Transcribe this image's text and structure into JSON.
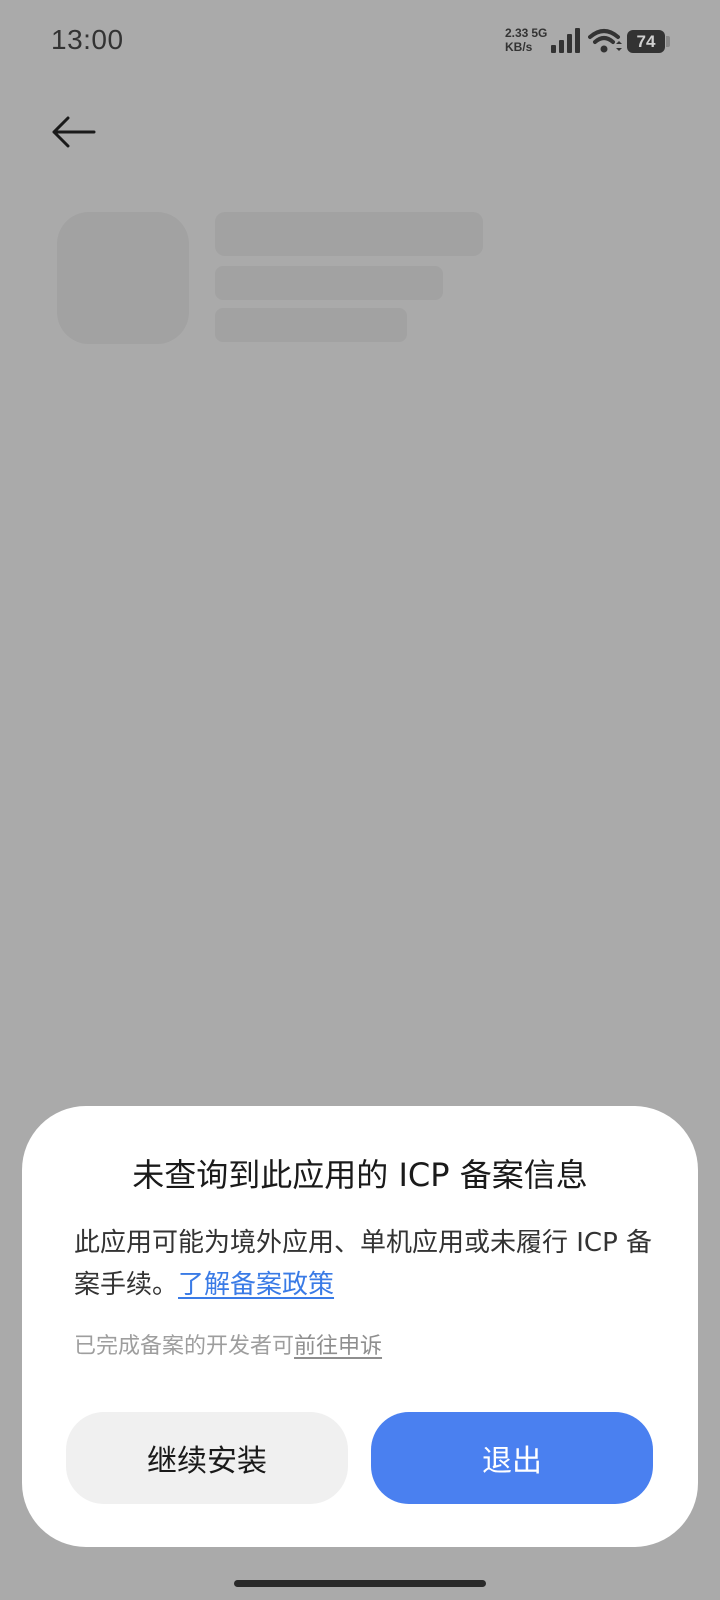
{
  "status_bar": {
    "time": "13:00",
    "net_speed_value": "2.33",
    "net_type": "5G",
    "net_speed_unit": "KB/s",
    "battery_level": "74",
    "icons": [
      "signal-icon",
      "wifi-icon",
      "battery-icon"
    ]
  },
  "header": {
    "back_icon": "arrow-left-icon"
  },
  "dialog": {
    "title": "未查询到此应用的 ICP 备案信息",
    "message": "此应用可能为境外应用、单机应用或未履行 ICP 备案手续。",
    "policy_link": "了解备案政策",
    "appeal_prefix": "已完成备案的开发者可",
    "appeal_link": "前往申诉",
    "continue_button": "继续安装",
    "exit_button": "退出"
  },
  "colors": {
    "overlay": "#aaaaaa",
    "accent": "#4a80f0",
    "link": "#3a7be6",
    "secondary_button": "#f0f0f0"
  }
}
